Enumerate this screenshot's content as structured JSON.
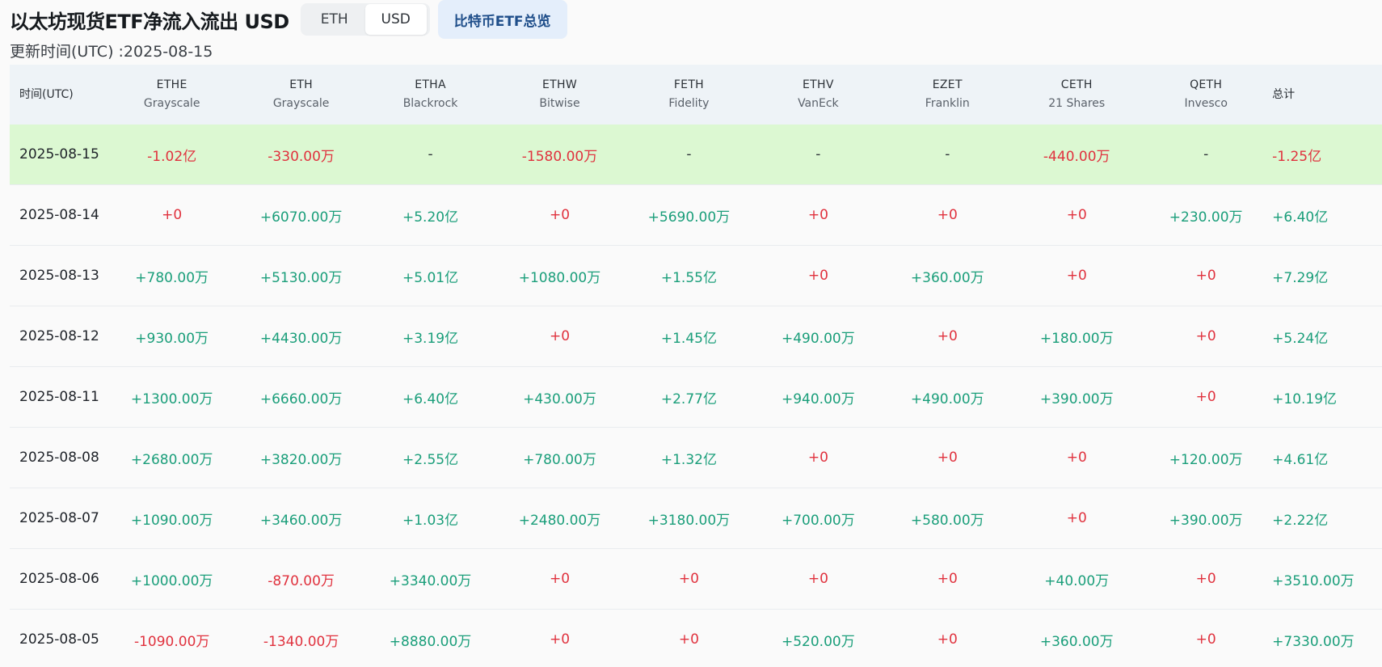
{
  "header": {
    "title": "以太坊现货ETF净流入流出 USD",
    "unit_options": [
      {
        "label": "ETH",
        "active": false
      },
      {
        "label": "USD",
        "active": true
      }
    ],
    "btc_overview_label": "比特币ETF总览",
    "update_text": "更新时间(UTC) :2025-08-15"
  },
  "table": {
    "time_header": "时间(UTC)",
    "total_header": "总计",
    "columns": [
      {
        "ticker": "ETHE",
        "issuer": "Grayscale"
      },
      {
        "ticker": "ETH",
        "issuer": "Grayscale"
      },
      {
        "ticker": "ETHA",
        "issuer": "Blackrock"
      },
      {
        "ticker": "ETHW",
        "issuer": "Bitwise"
      },
      {
        "ticker": "FETH",
        "issuer": "Fidelity"
      },
      {
        "ticker": "ETHV",
        "issuer": "VanEck"
      },
      {
        "ticker": "EZET",
        "issuer": "Franklin"
      },
      {
        "ticker": "CETH",
        "issuer": "21 Shares"
      },
      {
        "ticker": "QETH",
        "issuer": "Invesco"
      }
    ],
    "rows": [
      {
        "date": "2025-08-15",
        "highlight": true,
        "values": [
          "-1.02亿",
          "-330.00万",
          "-",
          "-1580.00万",
          "-",
          "-",
          "-",
          "-440.00万",
          "-"
        ],
        "total": "-1.25亿"
      },
      {
        "date": "2025-08-14",
        "highlight": false,
        "values": [
          "+0",
          "+6070.00万",
          "+5.20亿",
          "+0",
          "+5690.00万",
          "+0",
          "+0",
          "+0",
          "+230.00万"
        ],
        "total": "+6.40亿"
      },
      {
        "date": "2025-08-13",
        "highlight": false,
        "values": [
          "+780.00万",
          "+5130.00万",
          "+5.01亿",
          "+1080.00万",
          "+1.55亿",
          "+0",
          "+360.00万",
          "+0",
          "+0"
        ],
        "total": "+7.29亿"
      },
      {
        "date": "2025-08-12",
        "highlight": false,
        "values": [
          "+930.00万",
          "+4430.00万",
          "+3.19亿",
          "+0",
          "+1.45亿",
          "+490.00万",
          "+0",
          "+180.00万",
          "+0"
        ],
        "total": "+5.24亿"
      },
      {
        "date": "2025-08-11",
        "highlight": false,
        "values": [
          "+1300.00万",
          "+6660.00万",
          "+6.40亿",
          "+430.00万",
          "+2.77亿",
          "+940.00万",
          "+490.00万",
          "+390.00万",
          "+0"
        ],
        "total": "+10.19亿"
      },
      {
        "date": "2025-08-08",
        "highlight": false,
        "values": [
          "+2680.00万",
          "+3820.00万",
          "+2.55亿",
          "+780.00万",
          "+1.32亿",
          "+0",
          "+0",
          "+0",
          "+120.00万"
        ],
        "total": "+4.61亿"
      },
      {
        "date": "2025-08-07",
        "highlight": false,
        "values": [
          "+1090.00万",
          "+3460.00万",
          "+1.03亿",
          "+2480.00万",
          "+3180.00万",
          "+700.00万",
          "+580.00万",
          "+0",
          "+390.00万"
        ],
        "total": "+2.22亿"
      },
      {
        "date": "2025-08-06",
        "highlight": false,
        "values": [
          "+1000.00万",
          "-870.00万",
          "+3340.00万",
          "+0",
          "+0",
          "+0",
          "+0",
          "+40.00万",
          "+0"
        ],
        "total": "+3510.00万"
      },
      {
        "date": "2025-08-05",
        "highlight": false,
        "values": [
          "-1090.00万",
          "-1340.00万",
          "+8880.00万",
          "+0",
          "+0",
          "+520.00万",
          "+0",
          "+360.00万",
          "+0"
        ],
        "total": "+7330.00万"
      }
    ]
  },
  "colors": {
    "positive": "#1a9e7a",
    "negative": "#e0323e",
    "highlight_row": "#dcf8d2",
    "header_bg": "#eef3f7",
    "btc_button_bg": "#e4eefb"
  }
}
